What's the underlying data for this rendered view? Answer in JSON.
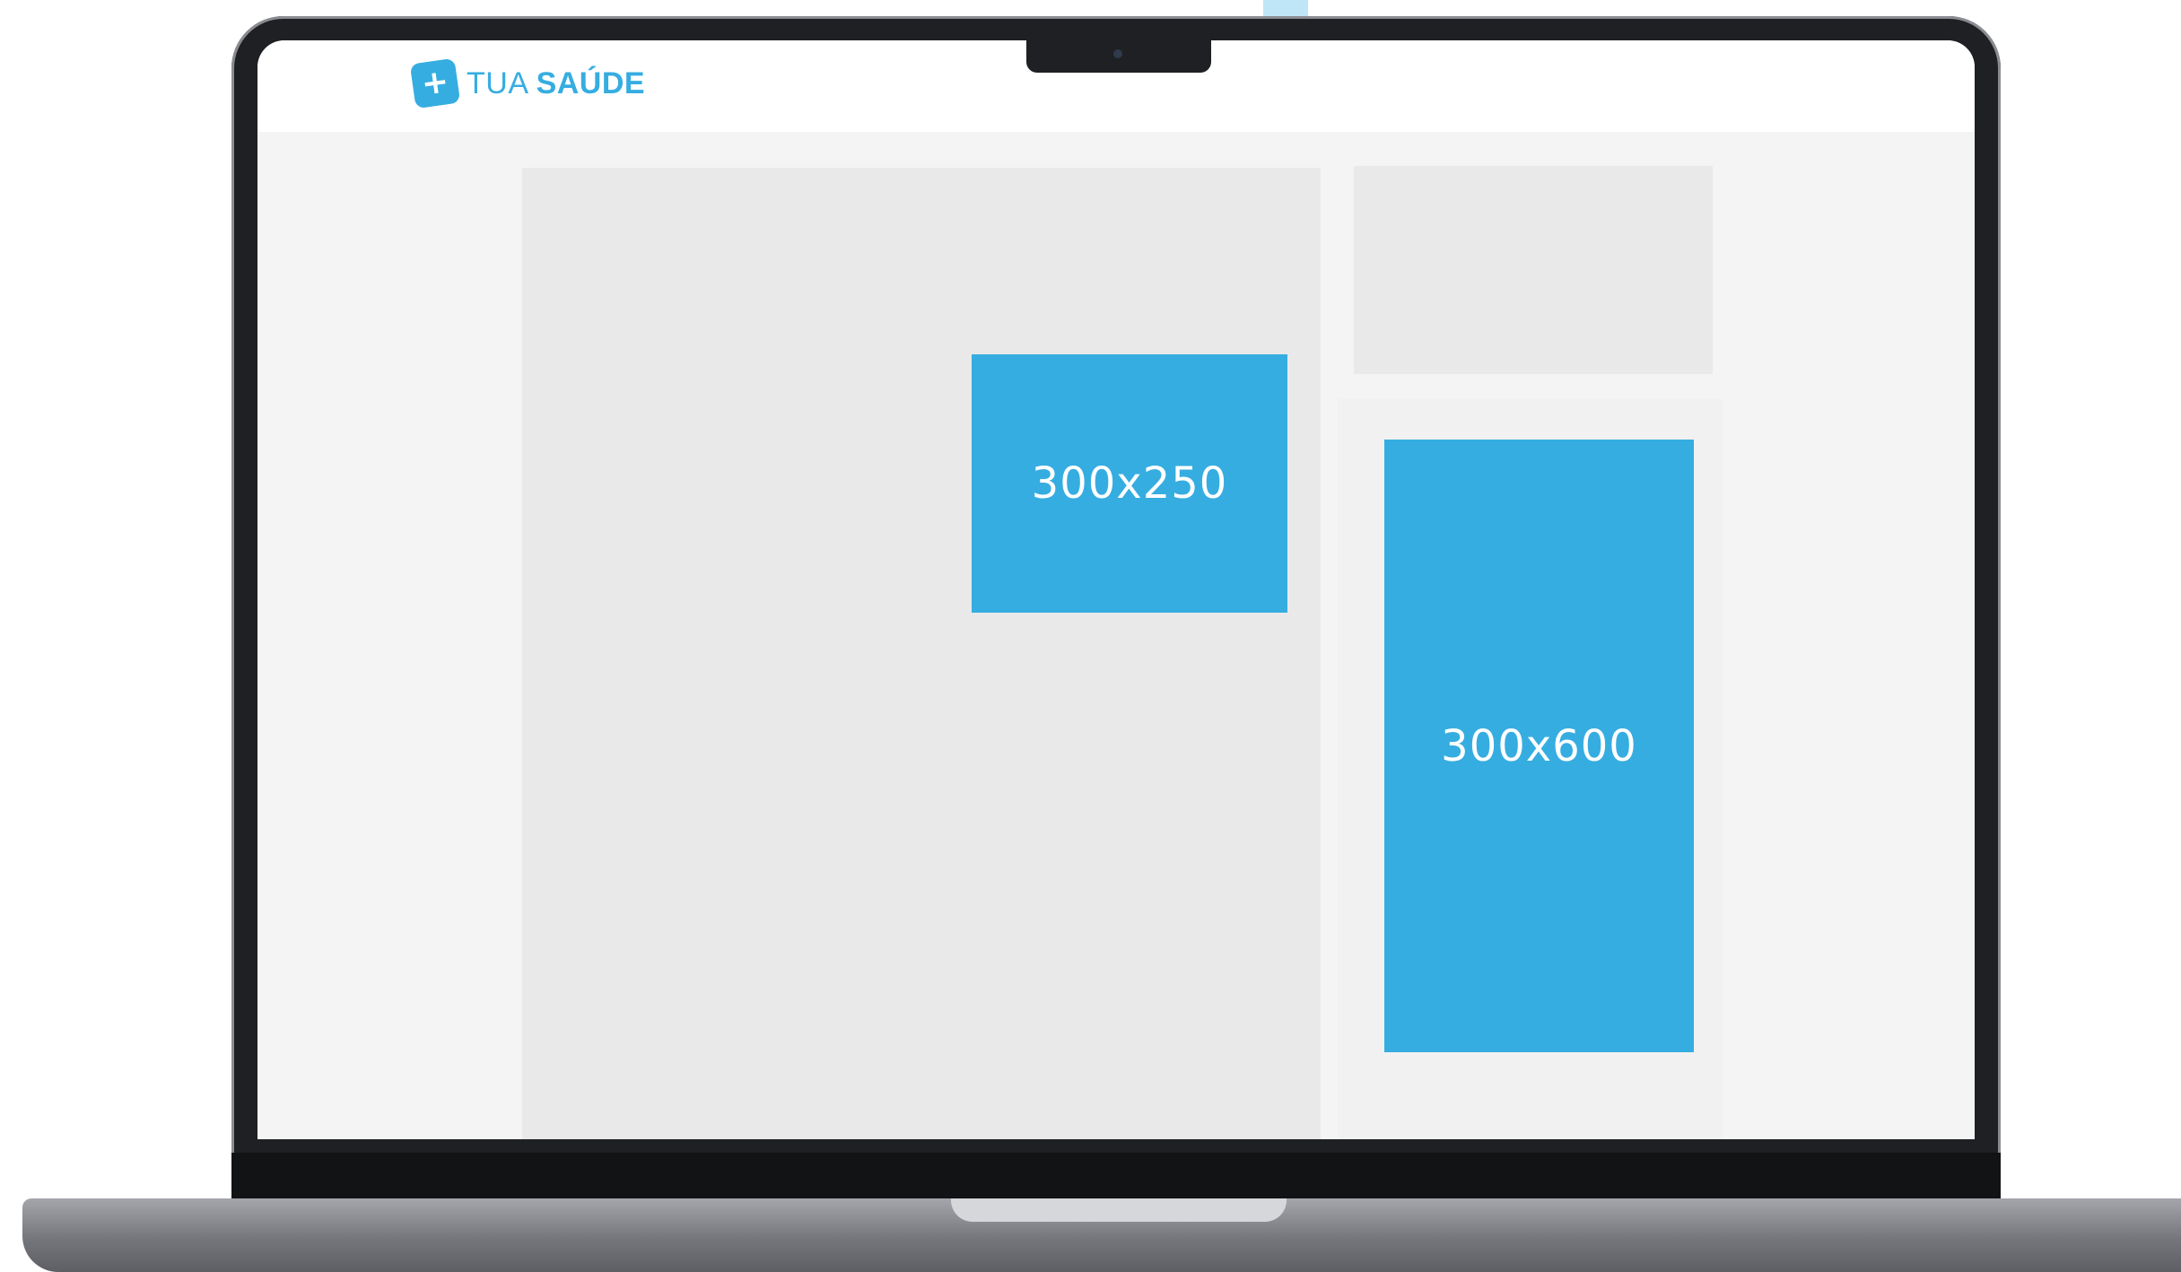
{
  "site": {
    "logo_symbol": "+",
    "logo_light": "TUA",
    "logo_bold": "SAÚDE",
    "brand_color": "#36ade1"
  },
  "ads": {
    "medium_rectangle": "300x250",
    "half_page": "300x600"
  },
  "colors": {
    "ad_blue": "#36ade1",
    "placeholder_gray": "#e9e9e9",
    "page_background": "#f4f4f4",
    "laptop_bezel": "#1f2023"
  }
}
